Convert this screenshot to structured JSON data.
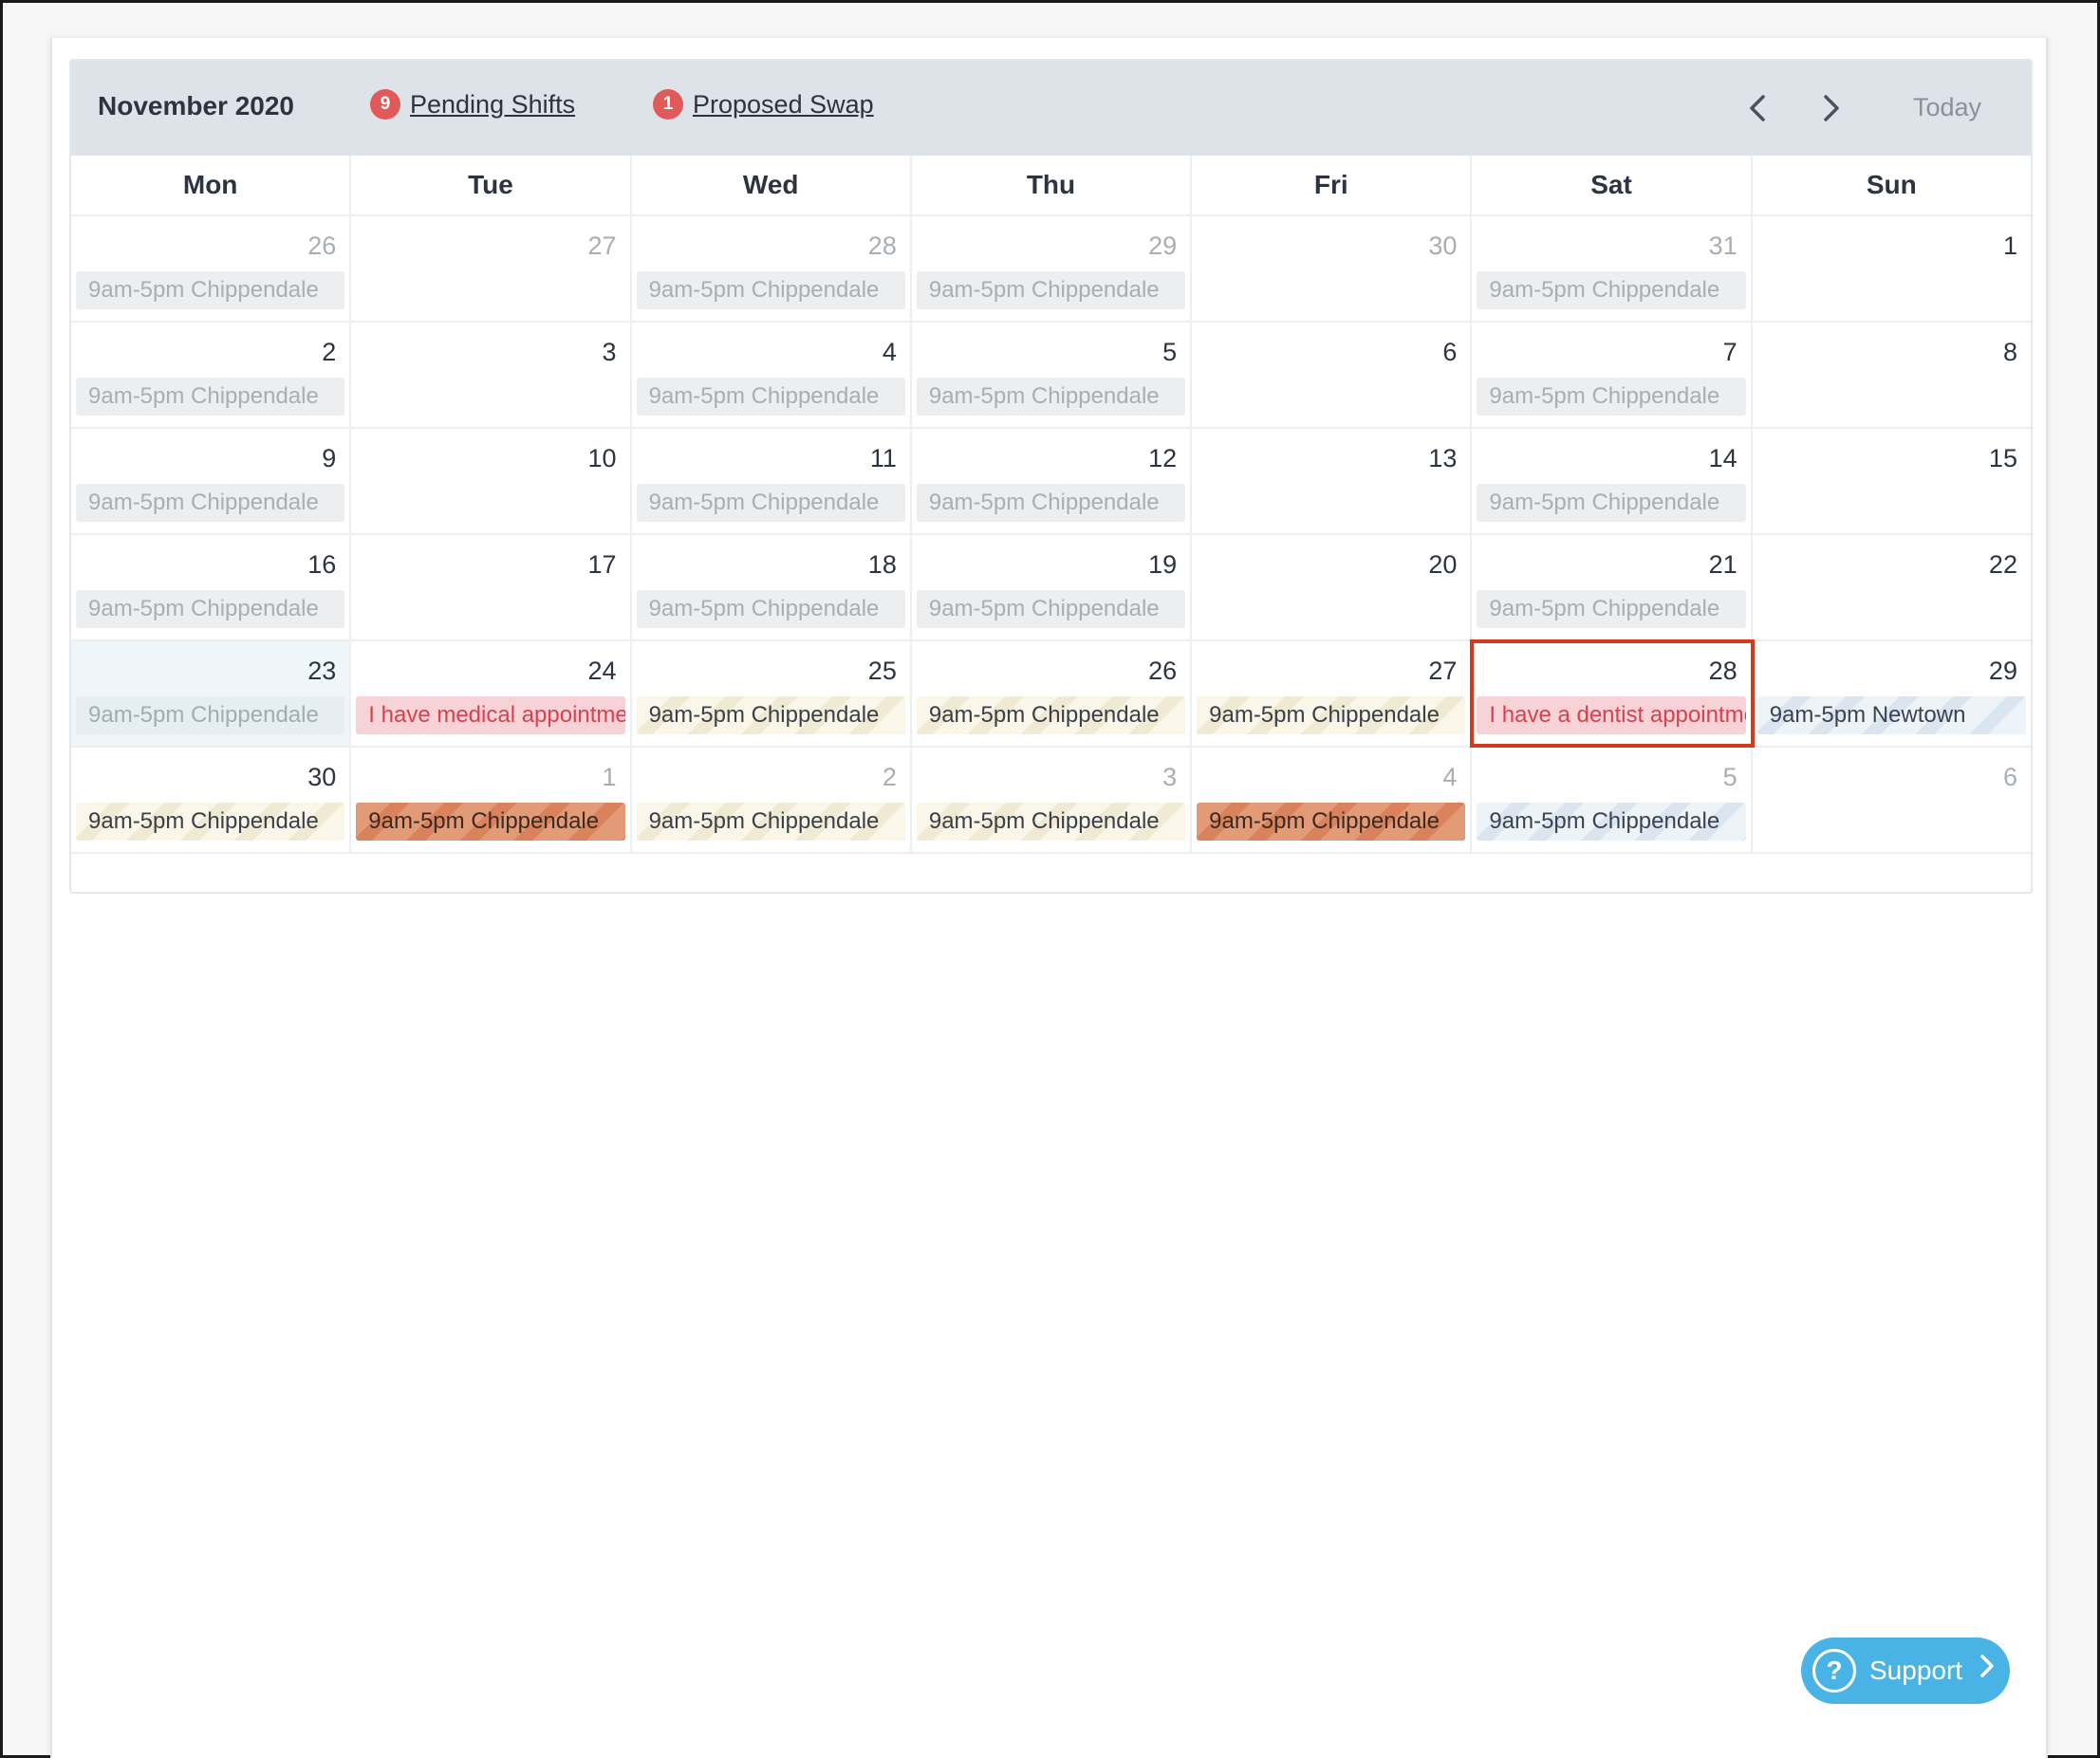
{
  "header": {
    "month_title": "November 2020",
    "pending": {
      "count": "9",
      "label": "Pending Shifts"
    },
    "swap": {
      "count": "1",
      "label": "Proposed Swap"
    },
    "today_label": "Today"
  },
  "weekdays": [
    "Mon",
    "Tue",
    "Wed",
    "Thu",
    "Fri",
    "Sat",
    "Sun"
  ],
  "weeks": [
    [
      {
        "num": "26",
        "muted": true,
        "event": "9am-5pm Chippendale",
        "style": "grey"
      },
      {
        "num": "27",
        "muted": true
      },
      {
        "num": "28",
        "muted": true,
        "event": "9am-5pm Chippendale",
        "style": "grey"
      },
      {
        "num": "29",
        "muted": true,
        "event": "9am-5pm Chippendale",
        "style": "grey"
      },
      {
        "num": "30",
        "muted": true
      },
      {
        "num": "31",
        "muted": true,
        "event": "9am-5pm Chippendale",
        "style": "grey"
      },
      {
        "num": "1"
      }
    ],
    [
      {
        "num": "2",
        "event": "9am-5pm Chippendale",
        "style": "grey"
      },
      {
        "num": "3"
      },
      {
        "num": "4",
        "event": "9am-5pm Chippendale",
        "style": "grey"
      },
      {
        "num": "5",
        "event": "9am-5pm Chippendale",
        "style": "grey"
      },
      {
        "num": "6"
      },
      {
        "num": "7",
        "event": "9am-5pm Chippendale",
        "style": "grey"
      },
      {
        "num": "8"
      }
    ],
    [
      {
        "num": "9",
        "event": "9am-5pm Chippendale",
        "style": "grey"
      },
      {
        "num": "10"
      },
      {
        "num": "11",
        "event": "9am-5pm Chippendale",
        "style": "grey"
      },
      {
        "num": "12",
        "event": "9am-5pm Chippendale",
        "style": "grey"
      },
      {
        "num": "13"
      },
      {
        "num": "14",
        "event": "9am-5pm Chippendale",
        "style": "grey"
      },
      {
        "num": "15"
      }
    ],
    [
      {
        "num": "16",
        "event": "9am-5pm Chippendale",
        "style": "grey"
      },
      {
        "num": "17"
      },
      {
        "num": "18",
        "event": "9am-5pm Chippendale",
        "style": "grey"
      },
      {
        "num": "19",
        "event": "9am-5pm Chippendale",
        "style": "grey"
      },
      {
        "num": "20"
      },
      {
        "num": "21",
        "event": "9am-5pm Chippendale",
        "style": "grey"
      },
      {
        "num": "22"
      }
    ],
    [
      {
        "num": "23",
        "highlight": true,
        "event": "9am-5pm Chippendale",
        "style": "grey-blue"
      },
      {
        "num": "24",
        "event": "I have medical appointment",
        "style": "pink"
      },
      {
        "num": "25",
        "event": "9am-5pm Chippendale",
        "style": "cream"
      },
      {
        "num": "26",
        "event": "9am-5pm Chippendale",
        "style": "cream"
      },
      {
        "num": "27",
        "event": "9am-5pm Chippendale",
        "style": "cream"
      },
      {
        "num": "28",
        "selected": true,
        "event": "I have a dentist appointment",
        "style": "pink"
      },
      {
        "num": "29",
        "event": "9am-5pm Newtown",
        "style": "blue"
      }
    ],
    [
      {
        "num": "30",
        "event": "9am-5pm Chippendale",
        "style": "cream"
      },
      {
        "num": "1",
        "muted": true,
        "event": "9am-5pm Chippendale",
        "style": "orange"
      },
      {
        "num": "2",
        "muted": true,
        "event": "9am-5pm Chippendale",
        "style": "cream"
      },
      {
        "num": "3",
        "muted": true,
        "event": "9am-5pm Chippendale",
        "style": "cream"
      },
      {
        "num": "4",
        "muted": true,
        "event": "9am-5pm Chippendale",
        "style": "orange"
      },
      {
        "num": "5",
        "muted": true,
        "event": "9am-5pm Chippendale",
        "style": "blue"
      },
      {
        "num": "6",
        "muted": true
      }
    ]
  ],
  "support": {
    "label": "Support",
    "icon": "question-icon"
  },
  "colors": {
    "header_bg": "#dde3e8",
    "badge": "#e05a5a",
    "selected_outline": "#d23b1e",
    "support_bg": "#4ab3e6"
  }
}
